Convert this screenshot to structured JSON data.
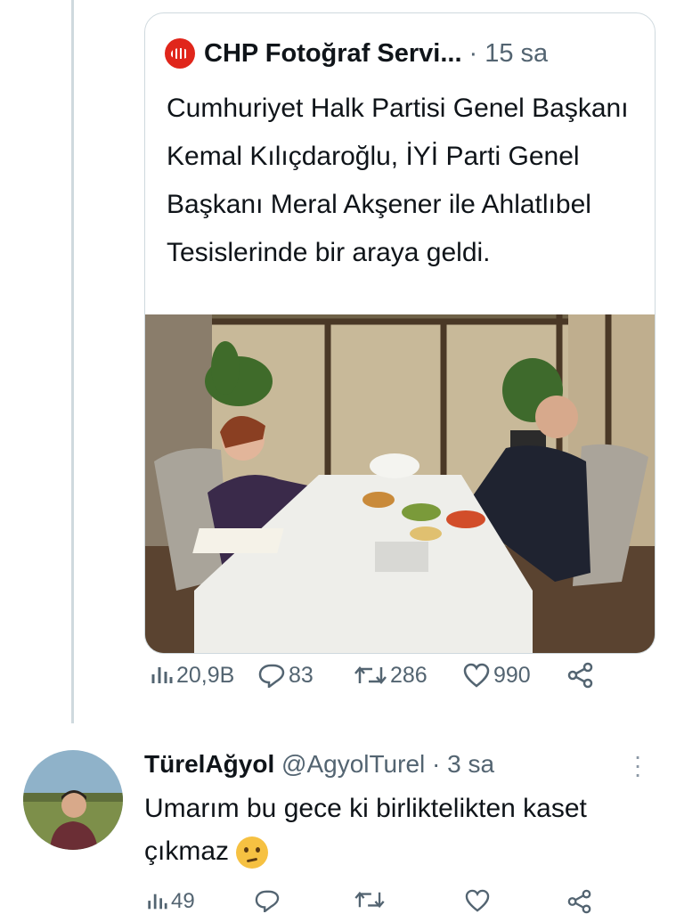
{
  "quoted_tweet": {
    "author_name": "CHP Fotoğraf Servi...",
    "separator": "·",
    "time": "15 sa",
    "text": "Cumhuriyet Halk Partisi Genel Başkanı Kemal Kılıçdaroğlu, İYİ Parti Genel Başkanı Meral Akşener ile Ahlatlıbel Tesislerinde bir araya geldi.",
    "logo_icon": "chp-logo-icon",
    "logo_color": "#e0261b"
  },
  "actions": {
    "views": "20,9B",
    "replies": "83",
    "retweets": "286",
    "likes": "990"
  },
  "reply": {
    "name": "TürelAğyol",
    "handle": "@AgyolTurel",
    "separator": "·",
    "time": "3 sa",
    "text": "Umarım bu gece ki birliktelikten kaset çıkmaz",
    "views": "49"
  },
  "colors": {
    "text": "#0f1419",
    "muted": "#536471",
    "border": "#cfd9de"
  }
}
